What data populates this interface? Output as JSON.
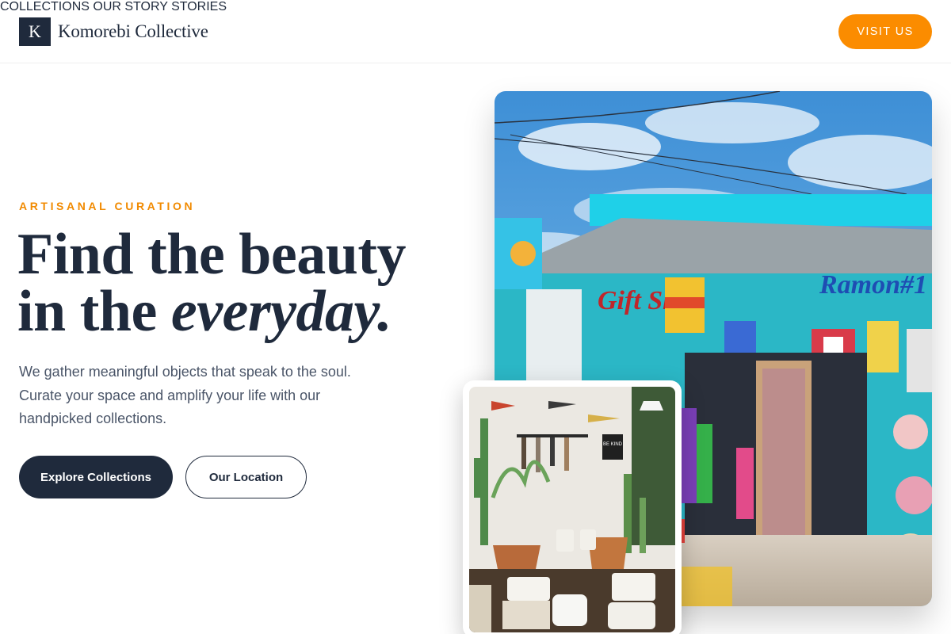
{
  "brand": {
    "mark": "K",
    "name": "Komorebi Collective"
  },
  "nav": {
    "items": [
      {
        "label": "COLLECTIONS"
      },
      {
        "label": "OUR STORY"
      },
      {
        "label": "STORIES"
      }
    ],
    "cta_label": "VISIT US"
  },
  "hero": {
    "eyebrow": "ARTISANAL CURATION",
    "headline_line1": "Find the beauty",
    "headline_line2_plain": "in the ",
    "headline_line2_italic": "everyday.",
    "subtext": "We gather meaningful objects that speak to the soul. Curate your space and amplify your life with our handpicked collections.",
    "primary_button": "Explore Collections",
    "secondary_button": "Our Location"
  },
  "photos": {
    "main_sign_1": "Gift Shop",
    "main_sign_2": "Ramon#1",
    "inset_sign": "BE KIND"
  },
  "colors": {
    "navy": "#1f2a3c",
    "accent_orange": "#fb8c00",
    "eyebrow_orange": "#f18a00",
    "body_text": "#4a5568"
  }
}
